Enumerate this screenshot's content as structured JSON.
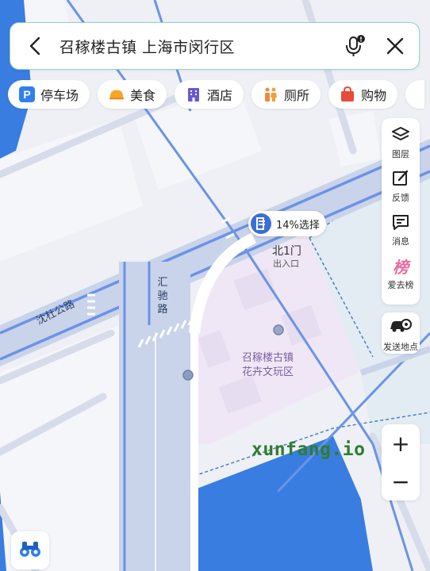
{
  "search": {
    "query": "召稼楼古镇 上海市闵行区"
  },
  "chips": [
    {
      "label": "停车场",
      "icon": "parking-icon",
      "color": "#2f80ed"
    },
    {
      "label": "美食",
      "icon": "food-icon",
      "color": "#f5a623"
    },
    {
      "label": "酒店",
      "icon": "hotel-icon",
      "color": "#6a5acd"
    },
    {
      "label": "厕所",
      "icon": "toilet-icon",
      "color": "#f08a3c"
    },
    {
      "label": "购物",
      "icon": "shopping-bag-icon",
      "color": "#e84a3c"
    }
  ],
  "toolbar": {
    "layers_label": "图层",
    "feedback_label": "反馈",
    "messages_label": "消息",
    "ranking_label": "爱去榜",
    "ranking_glyph": "榜",
    "send_location_label": "发送地点"
  },
  "zoom": {
    "in_label": "+",
    "out_label": "−"
  },
  "map": {
    "gate_badge": "14%选择",
    "gate_name": "北1门",
    "gate_sub": "出入口",
    "area_line1": "召稼楼古镇",
    "area_line2": "花卉文玩区",
    "road_huichi": "汇驰路",
    "road_shendu": "沈杜公路"
  },
  "watermark": "xunfang.io",
  "colors": {
    "road_major": "#6b93e6",
    "road_light": "#c9d3ea",
    "water": "#3a7de0",
    "scenic_area": "#efe7f6",
    "search_border": "#8fd3c6"
  }
}
